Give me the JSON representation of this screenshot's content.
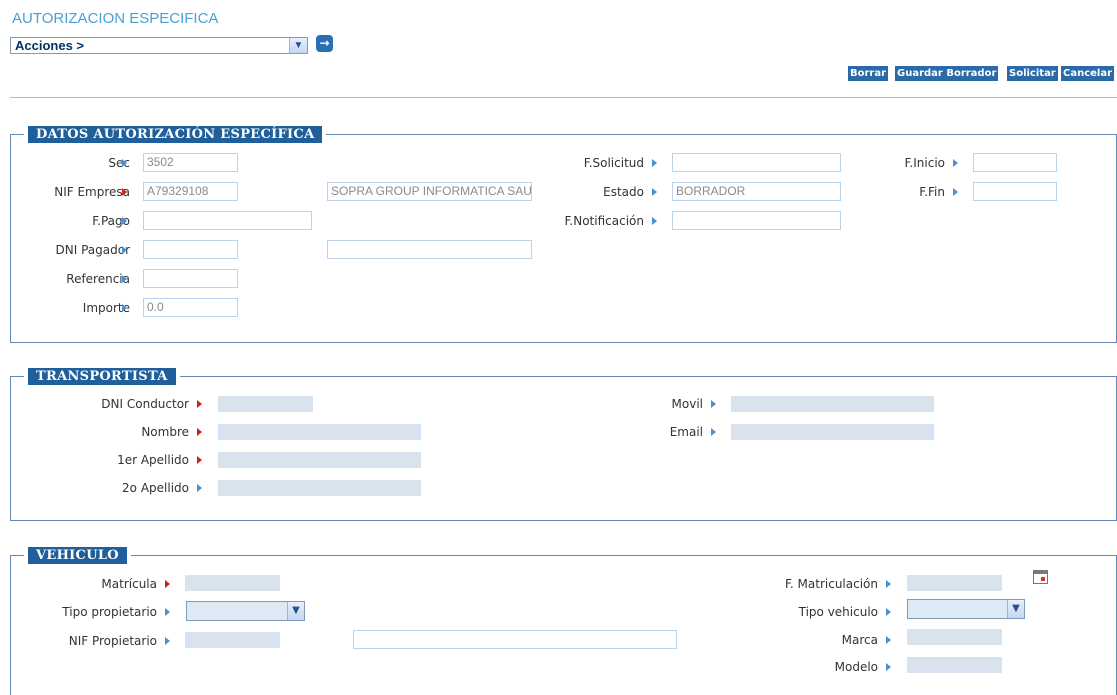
{
  "page": {
    "title": "AUTORIZACION ESPECIFICA",
    "actions_label": "Acciones >",
    "go_icon": "arrow-right-icon"
  },
  "toolbar": {
    "borrar": "Borrar",
    "guardar_borrador": "Guardar Borrador",
    "solicitar": "Solicitar",
    "cancelar": "Cancelar"
  },
  "datos": {
    "legend": "DATOS AUTORIZACIÓN ESPECÍFICA",
    "sec_label": "Sec",
    "sec_value": "3502",
    "nif_label": "NIF Empresa",
    "nif_value": "A79329108",
    "empresa_name": "SOPRA GROUP INFORMATICA SAU",
    "fpago_label": "F.Pago",
    "fpago_value": "",
    "dni_pagador_label": "DNI Pagador",
    "dni_pagador_value": "",
    "dni_pagador_name": "",
    "referencia_label": "Referencia",
    "referencia_value": "",
    "importe_label": "Importe",
    "importe_value": "0.0",
    "fsolicitud_label": "F.Solicitud",
    "fsolicitud_value": "",
    "estado_label": "Estado",
    "estado_value": "BORRADOR",
    "fnotificacion_label": "F.Notificación",
    "fnotificacion_value": "",
    "finicio_label": "F.Inicio",
    "finicio_value": "",
    "ffin_label": "F.Fin",
    "ffin_value": ""
  },
  "transportista": {
    "legend": "TRANSPORTISTA",
    "dni_label": "DNI Conductor",
    "nombre_label": "Nombre",
    "apellido1_label": "1er Apellido",
    "apellido2_label": "2o Apellido",
    "movil_label": "Movil",
    "email_label": "Email"
  },
  "vehiculo": {
    "legend": "VEHICULO",
    "matricula_label": "Matrícula",
    "tipo_propietario_label": "Tipo propietario",
    "nif_propietario_label": "NIF Propietario",
    "fmatriculacion_label": "F. Matriculación",
    "tipo_vehiculo_label": "Tipo vehiculo",
    "marca_label": "Marca",
    "modelo_label": "Modelo",
    "calendar_icon": "calendar-icon"
  },
  "colors": {
    "accent": "#1f5f9c",
    "title": "#4aa1d4",
    "required_arrow": "#d21f1f",
    "arrow": "#4a8fd0"
  }
}
